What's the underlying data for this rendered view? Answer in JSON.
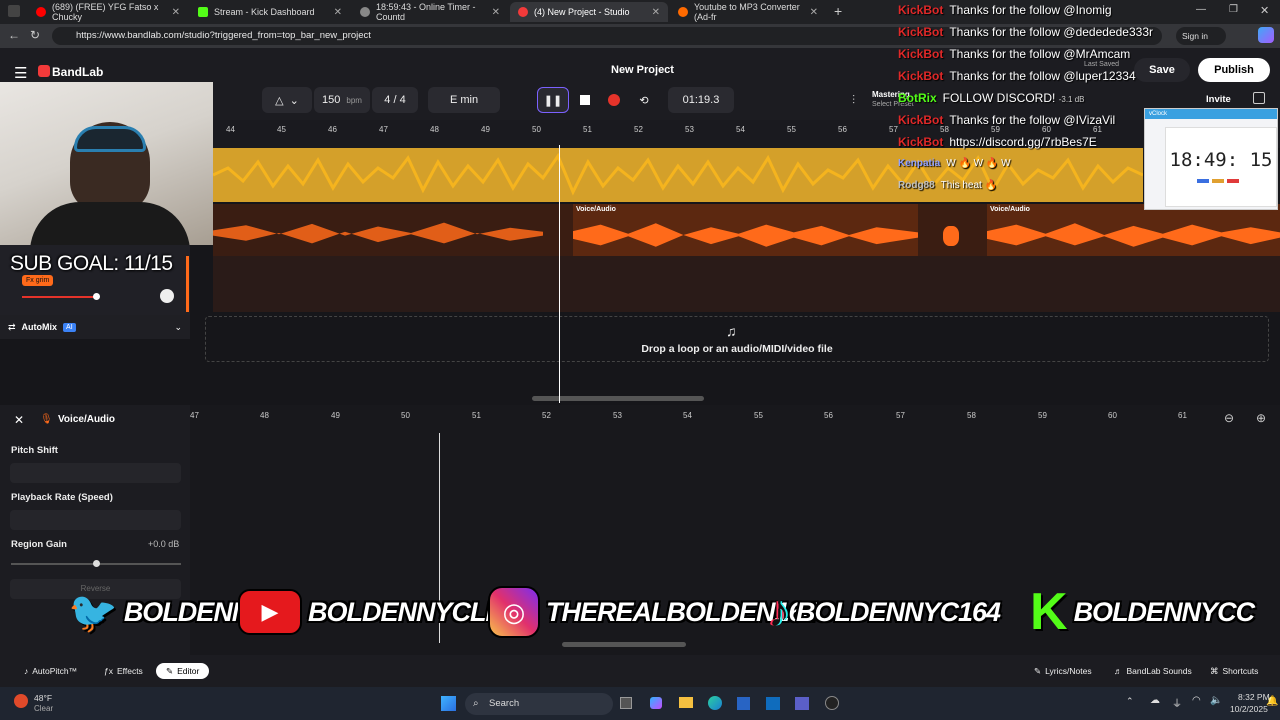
{
  "browser": {
    "tabs": [
      {
        "label": "(689) (FREE) YFG Fatso x Chucky",
        "color": "#ff0000"
      },
      {
        "label": "Stream - Kick Dashboard",
        "color": "#53fc18"
      },
      {
        "label": "18:59:43 - Online Timer - Countd",
        "color": "#888888"
      },
      {
        "label": "(4) New Project - Studio",
        "color": "#f23a3a"
      },
      {
        "label": "Youtube to MP3 Converter (Ad-fr",
        "color": "#ff6a00"
      }
    ],
    "url": "https://www.bandlab.com/studio?triggered_from=top_bar_new_project",
    "signin": "Sign in"
  },
  "bandlab": {
    "logo": "BandLab",
    "project_title": "New Project",
    "tempo": "150",
    "tempo_unit": "bpm",
    "time_sig": "4 / 4",
    "key": "E min",
    "time": "01:19.3",
    "mastering": "Mastering",
    "select_preset": "Select Preset",
    "last_saved": "Last Saved",
    "save": "Save",
    "publish": "Publish",
    "invite": "Invite",
    "level": "-3.1 dB",
    "ruler": [
      "44",
      "45",
      "46",
      "47",
      "48",
      "49",
      "50",
      "51",
      "52",
      "53",
      "54",
      "55",
      "56",
      "57",
      "58",
      "59",
      "60",
      "61"
    ],
    "clip_labels": [
      "Voice/Audio",
      "Voice/Audio"
    ],
    "fx_tag": "Fx grim",
    "automix": "AutoMix",
    "automix_badge": "AI",
    "dropzone": "Drop a loop or an audio/MIDI/video file"
  },
  "editor": {
    "track_name": "Voice/Audio",
    "pitch_shift": "Pitch Shift",
    "playback_rate": "Playback Rate (Speed)",
    "region_gain": "Region Gain",
    "region_gain_value": "+0.0 dB",
    "reverse": "Reverse",
    "ruler": [
      "47",
      "48",
      "49",
      "50",
      "51",
      "52",
      "53",
      "54",
      "55",
      "56",
      "57",
      "58",
      "59",
      "60",
      "61"
    ],
    "bottom_left": [
      "AutoPitch™",
      "Effects",
      "Editor"
    ],
    "bottom_right": [
      "Lyrics/Notes",
      "BandLab Sounds",
      "Shortcuts"
    ]
  },
  "overlay": {
    "sub_goal": "SUB GOAL: 11/15",
    "chat": [
      {
        "user": "KickBot",
        "msg": "Thanks for the follow @Inomig",
        "color": "#e02828"
      },
      {
        "user": "KickBot",
        "msg": "Thanks for the follow @dededede333r",
        "color": "#e02828"
      },
      {
        "user": "KickBot",
        "msg": "Thanks for the follow @MrAmcam",
        "color": "#e02828"
      },
      {
        "user": "KickBot",
        "msg": "Thanks for the follow @luper12334",
        "color": "#e02828"
      },
      {
        "user": "BotRix",
        "msg": "FOLLOW DISCORD!",
        "color": "#53fc18"
      },
      {
        "user": "KickBot",
        "msg": "Thanks for the follow @IVizaVil",
        "color": "#e02828"
      },
      {
        "user": "KickBot",
        "msg": "https://discord.gg/7rbBes7E",
        "color": "#e02828"
      },
      {
        "user": "Kenpatia",
        "msg": "W 🔥 W 🔥 W",
        "color": "#8fa0ff"
      },
      {
        "user": "Rodg88",
        "msg": "This heat 🔥",
        "color": "#c0c0c0"
      }
    ],
    "socials": [
      "BOLDENNYC",
      "BOLDENNYCLIVE",
      "THEREALBOLDEN164",
      "BOLDENNYC164",
      "BOLDENNYCC"
    ],
    "clock": "18:49: 15",
    "clock_title": "vClock"
  },
  "taskbar": {
    "weather_temp": "48°F",
    "weather_desc": "Clear",
    "search": "Search",
    "time": "8:32 PM",
    "date": "10/2/2025"
  },
  "colors": {
    "track_yellow": "#f5b41e",
    "track_orange": "#ff6a1a",
    "record": "#e5332a",
    "accent": "#7b61ff"
  }
}
